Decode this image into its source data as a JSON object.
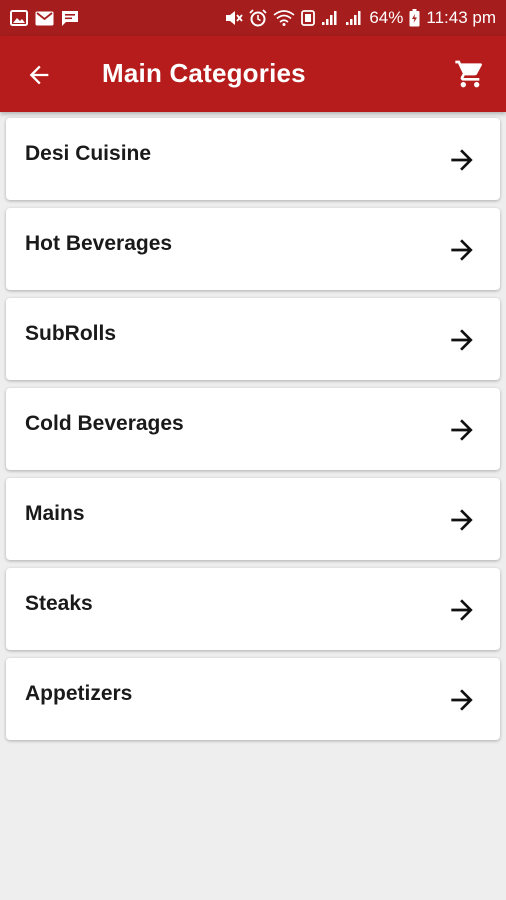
{
  "status_bar": {
    "battery": "64%",
    "time": "11:43 pm"
  },
  "app_bar": {
    "title": "Main Categories",
    "background": "#b71c1c"
  },
  "categories": [
    {
      "label": "Desi Cuisine"
    },
    {
      "label": "Hot Beverages"
    },
    {
      "label": "SubRolls"
    },
    {
      "label": "Cold Beverages"
    },
    {
      "label": "Mains"
    },
    {
      "label": "Steaks"
    },
    {
      "label": "Appetizers"
    }
  ],
  "icons": {
    "back": "arrow-back-icon",
    "cart": "shopping-cart-icon",
    "item_arrow": "arrow-forward-icon"
  }
}
